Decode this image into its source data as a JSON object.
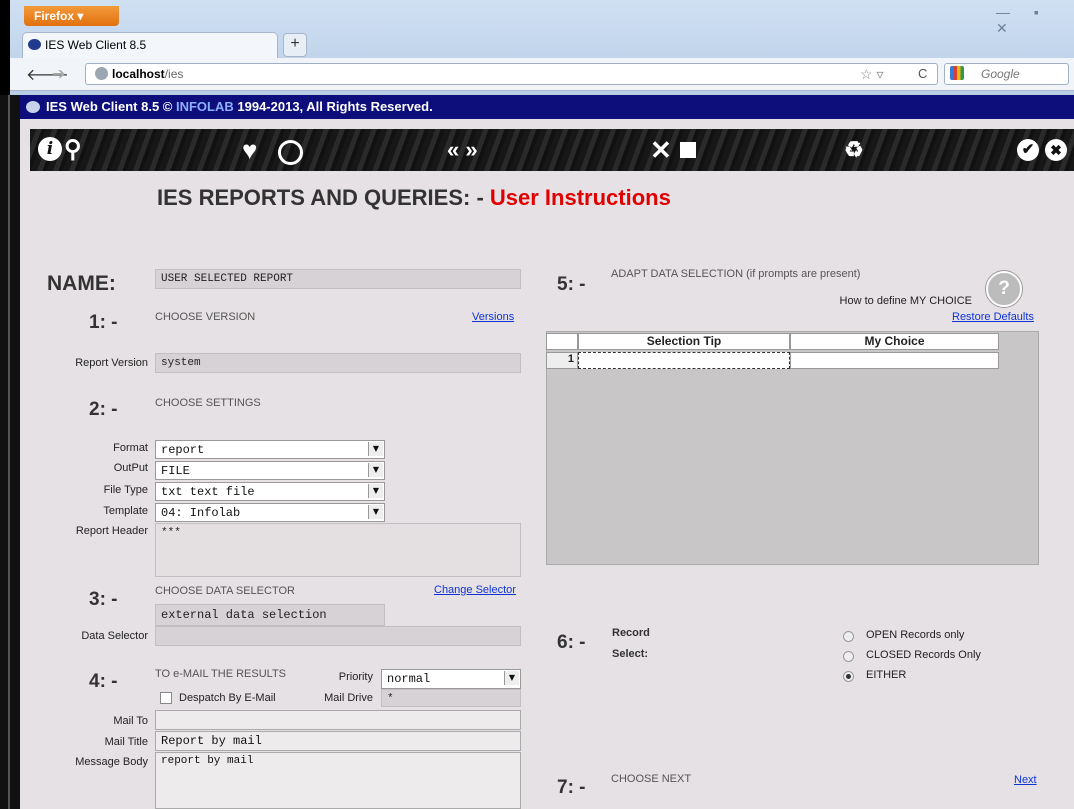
{
  "browser": {
    "menu_button": "Firefox",
    "window_controls": "— ▪ ✕",
    "tab_title": "IES Web Client 8.5",
    "new_tab": "+",
    "url_host": "localhost",
    "url_path": "/ies",
    "search_placeholder": "Google"
  },
  "banner": {
    "app": "IES Web Client 8.5 © ",
    "org": "INFOLAB",
    "rest": " 1994-2013, All Rights Reserved."
  },
  "toolbar_icons": [
    "info-icon",
    "search-icon",
    "heart-icon",
    "clock-icon",
    "rewind-icon",
    "forward-icon",
    "tools-icon",
    "stop-icon",
    "recycle-icon",
    "check-icon",
    "close-icon"
  ],
  "page_title": {
    "main": "IES REPORTS AND QUERIES: - ",
    "highlight": "User Instructions"
  },
  "name": {
    "label": "NAME:",
    "value": "USER SELECTED REPORT"
  },
  "sections": {
    "s1": {
      "num": "1: -",
      "title": "CHOOSE VERSION",
      "link": "Versions"
    },
    "s2": {
      "num": "2: -",
      "title": "CHOOSE SETTINGS"
    },
    "s3": {
      "num": "3: -",
      "title": "CHOOSE DATA SELECTOR",
      "link": "Change Selector"
    },
    "s4": {
      "num": "4: -",
      "title": "TO e-MAIL THE RESULTS"
    },
    "s5": {
      "num": "5: -",
      "title": "ADAPT DATA SELECTION (if prompts are present)"
    },
    "s6": {
      "num": "6: -",
      "title_line1": "Record",
      "title_line2": "Select:"
    },
    "s7": {
      "num": "7: -",
      "title": "CHOOSE NEXT",
      "link": "Next"
    }
  },
  "version": {
    "label": "Report Version",
    "value": "system"
  },
  "settings": {
    "format_label": "Format",
    "format_value": "report",
    "output_label": "OutPut",
    "output_value": "FILE",
    "filetype_label": "File Type",
    "filetype_value": "txt text file",
    "template_label": "Template",
    "template_value": "04: Infolab",
    "header_label": "Report Header",
    "header_value": "***"
  },
  "data_selector": {
    "value": "external data selection",
    "label": "Data Selector",
    "field_value": ""
  },
  "email": {
    "priority_label": "Priority",
    "priority_value": "normal",
    "despatch_label": "Despatch By E-Mail",
    "despatch_checked": false,
    "mail_drive_label": "Mail Drive",
    "mail_drive_value": "*",
    "mail_to_label": "Mail To",
    "mail_to_value": "",
    "mail_title_label": "Mail Title",
    "mail_title_value": "Report by mail",
    "body_label": "Message Body",
    "body_value": "report by mail"
  },
  "adapt": {
    "help_text": "How to define MY CHOICE",
    "help_icon": "?",
    "restore_link": "Restore Defaults",
    "columns": [
      "Selection Tip",
      "My Choice"
    ],
    "rows": [
      {
        "num": "1",
        "tip": "",
        "choice": ""
      }
    ]
  },
  "record_select": {
    "options": [
      {
        "label": "OPEN Records only",
        "checked": false
      },
      {
        "label": "CLOSED Records Only",
        "checked": false
      },
      {
        "label": "EITHER",
        "checked": true
      }
    ]
  }
}
